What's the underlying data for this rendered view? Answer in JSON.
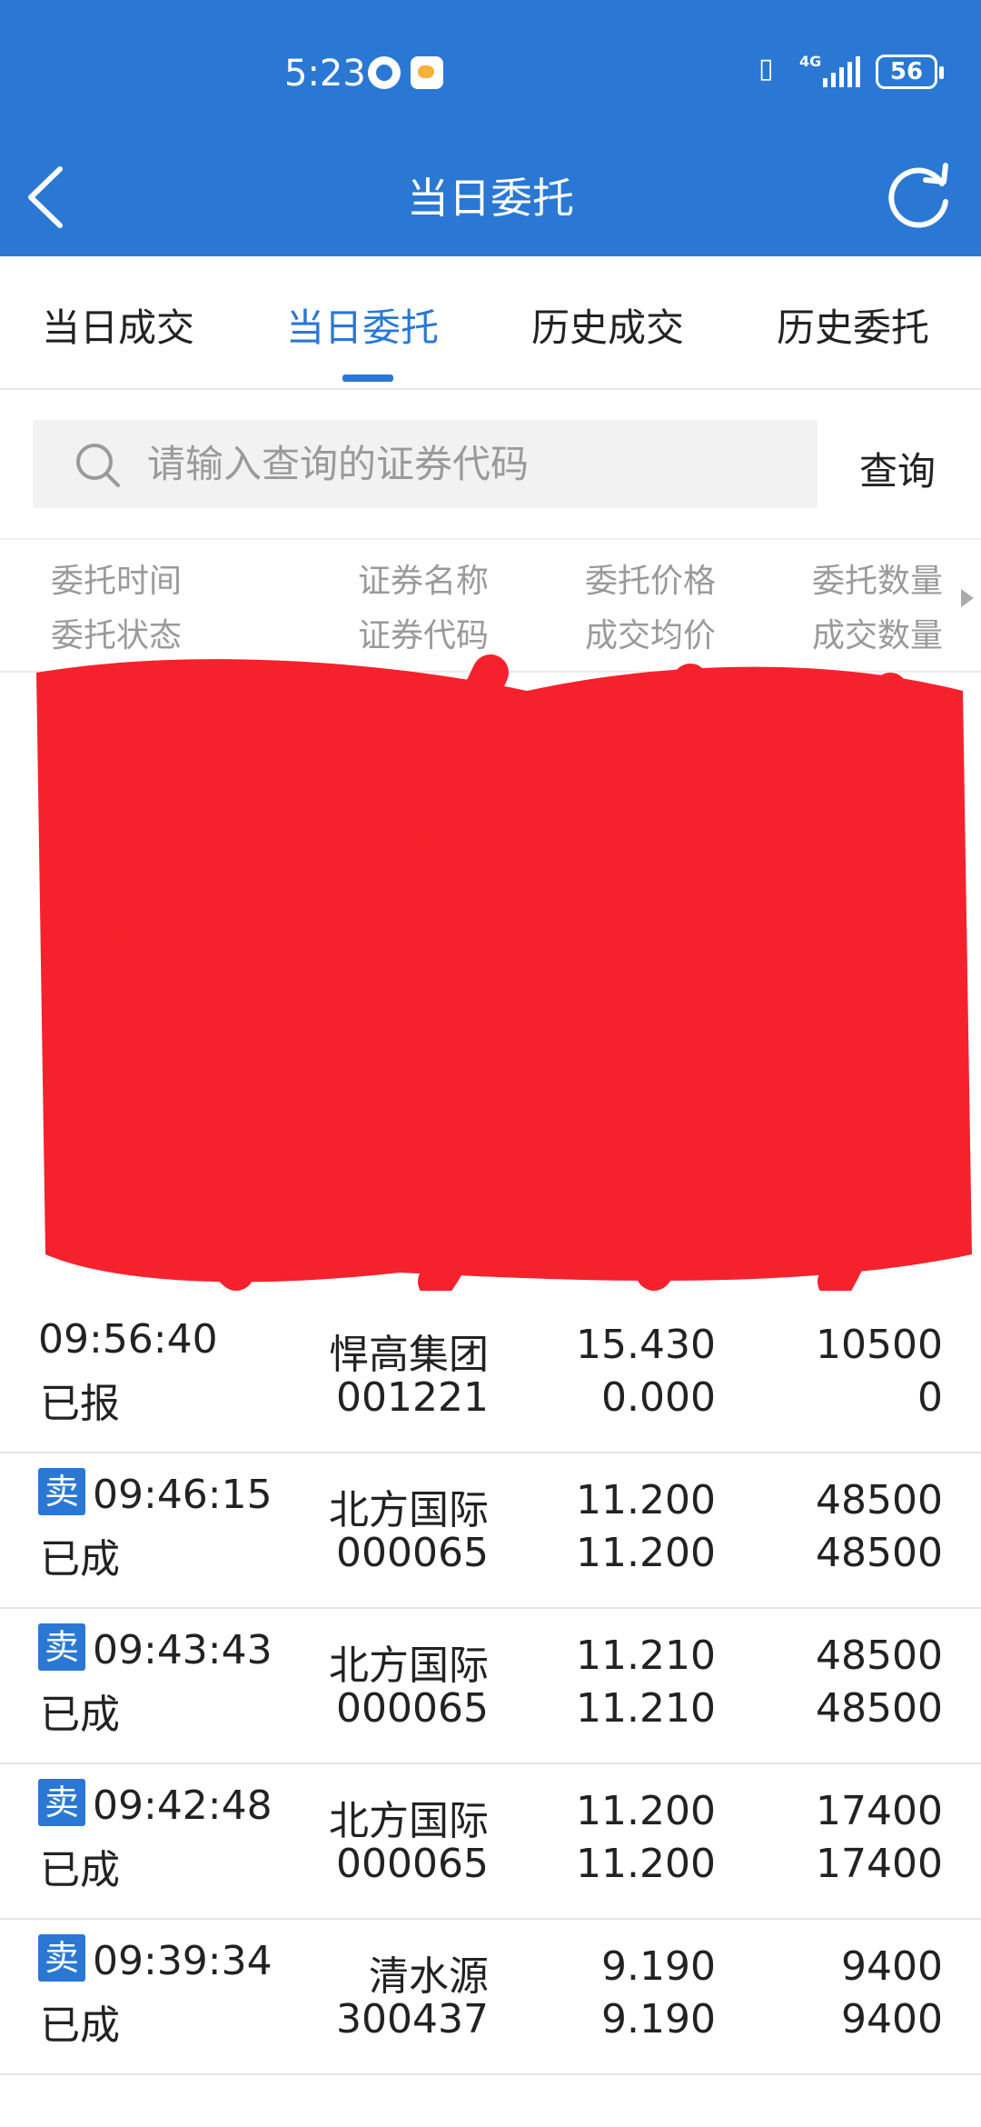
{
  "status_bar": {
    "time": "5:23",
    "network": "4G",
    "battery": "56"
  },
  "header": {
    "title": "当日委托",
    "back_icon": "chevron-left-icon",
    "refresh_icon": "refresh-icon"
  },
  "tabs": [
    {
      "label": "当日成交",
      "active": false
    },
    {
      "label": "当日委托",
      "active": true
    },
    {
      "label": "历史成交",
      "active": false
    },
    {
      "label": "历史委托",
      "active": false
    }
  ],
  "search": {
    "placeholder": "请输入查询的证券代码",
    "button_label": "查询"
  },
  "table": {
    "columns": [
      {
        "top": "委托时间",
        "bottom": "委托状态"
      },
      {
        "top": "证券名称",
        "bottom": "证券代码"
      },
      {
        "top": "委托价格",
        "bottom": "成交均价"
      },
      {
        "top": "委托数量",
        "bottom": "成交数量"
      }
    ],
    "rows": [
      {
        "side": "",
        "time": "09:56:40",
        "status": "已报",
        "name": "悍高集团",
        "code": "001221",
        "price": "15.430",
        "avg_price": "0.000",
        "qty": "10500",
        "filled_qty": "0"
      },
      {
        "side": "卖",
        "time": "09:46:15",
        "status": "已成",
        "name": "北方国际",
        "code": "000065",
        "price": "11.200",
        "avg_price": "11.200",
        "qty": "48500",
        "filled_qty": "48500"
      },
      {
        "side": "卖",
        "time": "09:43:43",
        "status": "已成",
        "name": "北方国际",
        "code": "000065",
        "price": "11.210",
        "avg_price": "11.210",
        "qty": "48500",
        "filled_qty": "48500"
      },
      {
        "side": "卖",
        "time": "09:42:48",
        "status": "已成",
        "name": "北方国际",
        "code": "000065",
        "price": "11.200",
        "avg_price": "11.200",
        "qty": "17400",
        "filled_qty": "17400"
      },
      {
        "side": "卖",
        "time": "09:39:34",
        "status": "已成",
        "name": "清水源",
        "code": "300437",
        "price": "9.190",
        "avg_price": "9.190",
        "qty": "9400",
        "filled_qty": "9400"
      }
    ]
  },
  "colors": {
    "brand": "#2a78d4",
    "redaction": "#f5222d"
  }
}
